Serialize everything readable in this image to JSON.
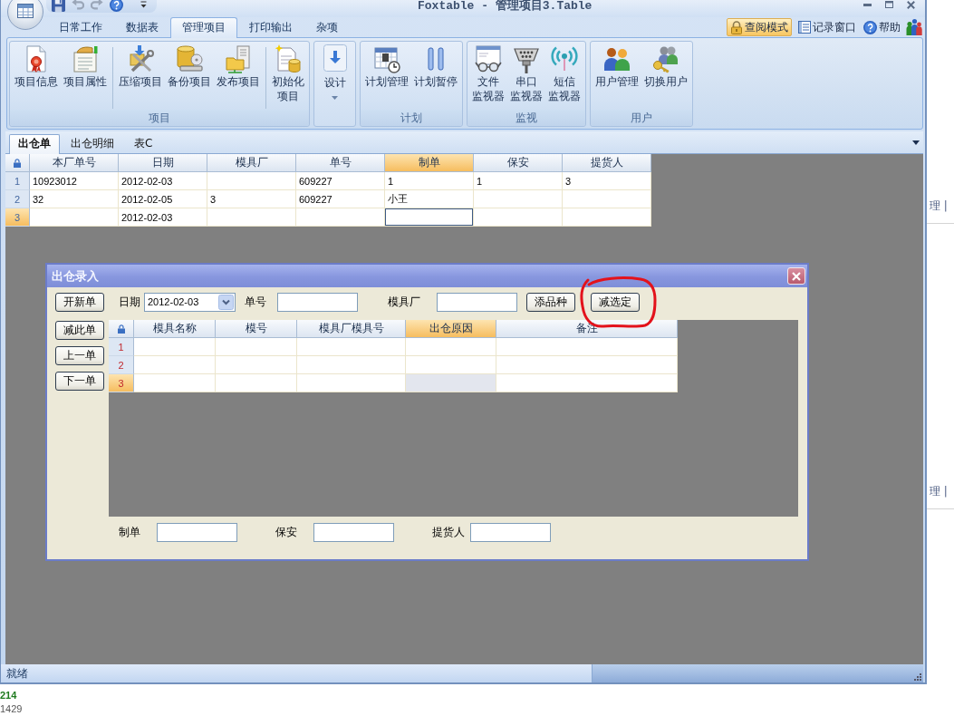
{
  "window": {
    "title": "Foxtable - 管理项目3.Table"
  },
  "ribbon": {
    "tabs": [
      {
        "label": "日常工作",
        "selected": false
      },
      {
        "label": "数据表",
        "selected": false
      },
      {
        "label": "管理项目",
        "selected": true
      },
      {
        "label": "打印输出",
        "selected": false
      },
      {
        "label": "杂项",
        "selected": false
      }
    ],
    "tools": [
      {
        "label": "查阅模式",
        "on": true
      },
      {
        "label": "记录窗口",
        "on": false
      },
      {
        "label": "帮助",
        "on": false
      }
    ],
    "groups": [
      {
        "kind": "group",
        "title": "项目",
        "buttons": [
          {
            "lines": [
              "项目信息"
            ],
            "separator": false
          },
          {
            "lines": [
              "项目属性"
            ],
            "separator": false
          },
          {
            "lines": [
              "压缩项目"
            ],
            "separator": true
          },
          {
            "lines": [
              "备份项目"
            ],
            "separator": false
          },
          {
            "lines": [
              "发布项目"
            ],
            "separator": false
          },
          {
            "lines": [
              "初始化",
              "项目"
            ],
            "separator": true
          }
        ]
      },
      {
        "kind": "dropdown",
        "label": "设计"
      },
      {
        "kind": "group",
        "title": "计划",
        "buttons": [
          {
            "lines": [
              "计划管理"
            ],
            "separator": false
          },
          {
            "lines": [
              "计划暂停"
            ],
            "separator": false
          }
        ]
      },
      {
        "kind": "group",
        "title": "监视",
        "buttons": [
          {
            "lines": [
              "文件",
              "监视器"
            ],
            "separator": false
          },
          {
            "lines": [
              "串口",
              "监视器"
            ],
            "separator": false
          },
          {
            "lines": [
              "短信",
              "监视器"
            ],
            "separator": false
          }
        ]
      },
      {
        "kind": "group",
        "title": "用户",
        "buttons": [
          {
            "lines": [
              "用户管理"
            ],
            "separator": false
          },
          {
            "lines": [
              "切换用户"
            ],
            "separator": false
          }
        ]
      }
    ]
  },
  "sheet_tabs": [
    {
      "label": "出仓单",
      "selected": true
    },
    {
      "label": "出仓明细",
      "selected": false
    },
    {
      "label": "表C",
      "selected": false
    }
  ],
  "grid": {
    "columns": [
      {
        "label": "本厂单号",
        "selected": false
      },
      {
        "label": "日期",
        "selected": false
      },
      {
        "label": "模具厂",
        "selected": false
      },
      {
        "label": "单号",
        "selected": false
      },
      {
        "label": "制单",
        "selected": true
      },
      {
        "label": "保安",
        "selected": false
      },
      {
        "label": "提货人",
        "selected": false
      }
    ],
    "rows": [
      {
        "number": "1",
        "selected": false,
        "cells": [
          "10923012",
          "2012-02-03",
          null,
          "609227",
          "1",
          "1",
          "3"
        ]
      },
      {
        "number": "2",
        "selected": false,
        "cells": [
          "32",
          "2012-02-05",
          "3",
          "609227",
          "小王",
          null,
          null
        ]
      },
      {
        "number": "3",
        "selected": true,
        "cells": [
          null,
          "2012-02-03",
          null,
          null,
          null,
          null,
          null
        ]
      }
    ]
  },
  "dialog": {
    "title": "出仓录入",
    "toolbar": [
      {
        "kind": "button",
        "label": "开新单",
        "circled": false
      },
      {
        "kind": "date",
        "label": "日期",
        "value": "2012-02-03",
        "circled": false
      },
      {
        "kind": "field",
        "label": "单号",
        "circled": false
      },
      {
        "kind": "field",
        "label": "模具厂",
        "circled": false
      },
      {
        "kind": "button",
        "label": "添品种",
        "circled": false
      },
      {
        "kind": "button",
        "label": "减选定",
        "circled": true
      }
    ],
    "side_buttons": [
      "减此单",
      "上一单",
      "下一单"
    ],
    "grid": {
      "columns": [
        {
          "label": "模具名称",
          "selected": false
        },
        {
          "label": "模号",
          "selected": false
        },
        {
          "label": "模具厂模具号",
          "selected": false
        },
        {
          "label": "出仓原因",
          "selected": true
        },
        {
          "label": "备注",
          "selected": false
        }
      ],
      "rows": [
        {
          "number": "1",
          "selected": false
        },
        {
          "number": "2",
          "selected": false
        },
        {
          "number": "3",
          "selected": true
        }
      ]
    },
    "footer_fields": [
      {
        "label": "制单"
      },
      {
        "label": "保安"
      },
      {
        "label": "提货人"
      }
    ]
  },
  "status_bar": {
    "text": "就绪"
  },
  "background": {
    "side_texts": [
      "理 |",
      "理 |"
    ],
    "bottom_texts": [
      {
        "text": "214",
        "color": "#1e7a1e"
      },
      {
        "text": "1429",
        "color": "#555555"
      }
    ]
  }
}
